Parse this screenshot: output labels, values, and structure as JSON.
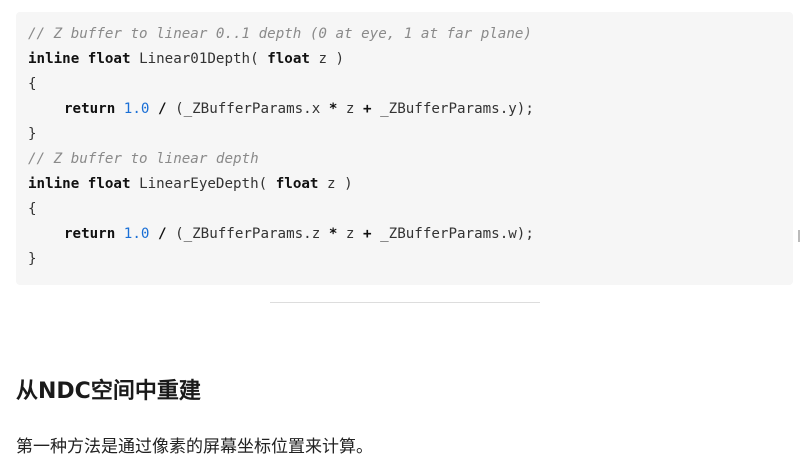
{
  "code": {
    "line1_comment": "// Z buffer to linear 0..1 depth (0 at eye, 1 at far plane)",
    "line2_kw1": "inline",
    "line2_kw2": "float",
    "line2_name": "Linear01Depth(",
    "line2_kw3": "float",
    "line2_rest": "z )",
    "line3_brace": "{",
    "line4_kw": "return",
    "line4_num": "1.0",
    "line4_op1": "/",
    "line4_mid": "(_ZBufferParams.x",
    "line4_op2": "*",
    "line4_z": "z",
    "line4_op3": "+",
    "line4_end": "_ZBufferParams.y);",
    "line5_brace": "}",
    "line6_comment": "// Z buffer to linear depth",
    "line7_kw1": "inline",
    "line7_kw2": "float",
    "line7_name": "LinearEyeDepth(",
    "line7_kw3": "float",
    "line7_rest": "z )",
    "line8_brace": "{",
    "line9_kw": "return",
    "line9_num": "1.0",
    "line9_op1": "/",
    "line9_mid": "(_ZBufferParams.z",
    "line9_op2": "*",
    "line9_z": "z",
    "line9_op3": "+",
    "line9_end": "_ZBufferParams.w);",
    "line10_brace": "}"
  },
  "section": {
    "heading": "从NDC空间中重建",
    "paragraph": "第一种方法是通过像素的屏幕坐标位置来计算。"
  }
}
